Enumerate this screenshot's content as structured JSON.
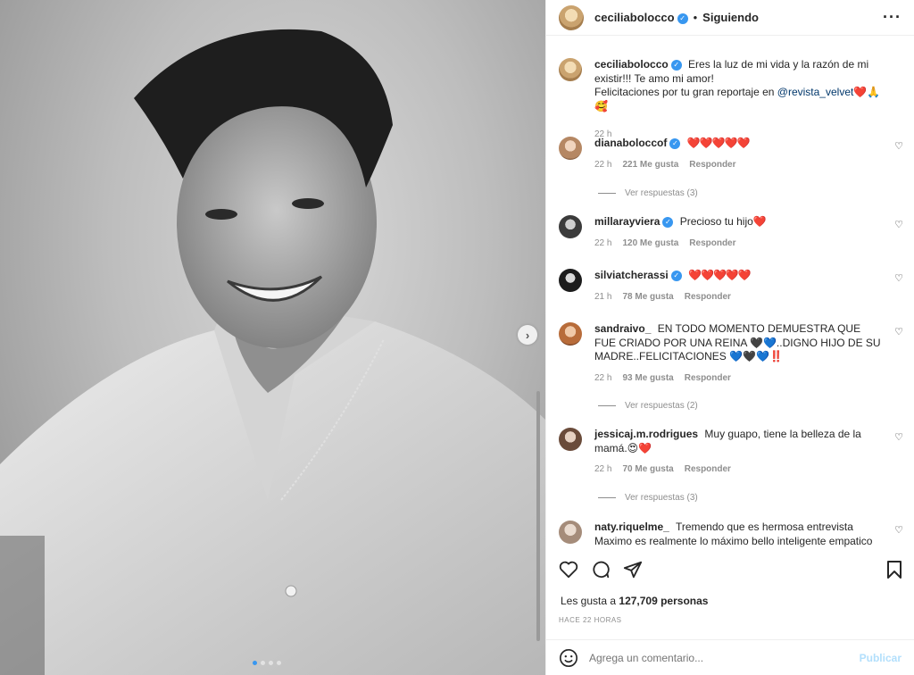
{
  "post": {
    "image_alt": "Black and white portrait photo",
    "carousel": {
      "count": 4,
      "active_index": 0
    }
  },
  "header": {
    "username": "ceciliabolocco",
    "separator": "•",
    "follow_status": "Siguiendo",
    "more_icon": "more-horizontal-icon"
  },
  "caption": {
    "username": "ceciliabolocco",
    "text_line1": "Eres la luz de mi vida y la razón de mi existir!!! Te amo mi amor!",
    "text_line2_prefix": "Felicitaciones por tu gran reportaje en ",
    "mention": "@revista_velvet",
    "emoji": "❤️🙏🥰",
    "time": "22 h"
  },
  "comments": [
    {
      "username": "dianaboloccof",
      "verified": true,
      "text": "❤️❤️❤️❤️❤️",
      "time": "22 h",
      "likes": "221 Me gusta",
      "reply": "Responder",
      "view_replies": "Ver respuestas (3)"
    },
    {
      "username": "millarayviera",
      "verified": true,
      "text": "Precioso tu hijo❤️",
      "time": "22 h",
      "likes": "120 Me gusta",
      "reply": "Responder",
      "view_replies": ""
    },
    {
      "username": "silviatcherassi",
      "verified": true,
      "text": "❤️❤️❤️❤️❤️",
      "time": "21 h",
      "likes": "78 Me gusta",
      "reply": "Responder",
      "view_replies": ""
    },
    {
      "username": "sandraivo_",
      "verified": false,
      "text": "EN TODO MOMENTO DEMUESTRA QUE FUE CRIADO POR UNA REINA 🖤💙..DIGNO HIJO DE SU MADRE..FELICITACIONES 💙🖤💙‼️",
      "time": "22 h",
      "likes": "93 Me gusta",
      "reply": "Responder",
      "view_replies": "Ver respuestas (2)"
    },
    {
      "username": "jessicaj.m.rodrigues",
      "verified": false,
      "text": "Muy guapo, tiene la belleza de la mamá.😍❤️",
      "time": "22 h",
      "likes": "70 Me gusta",
      "reply": "Responder",
      "view_replies": "Ver respuestas (3)"
    },
    {
      "username": "naty.riquelme_",
      "verified": false,
      "text": "Tremendo que es hermosa entrevista Maximo es realmente lo máximo bello inteligente empatico humilde lo amo",
      "time": "",
      "likes": "",
      "reply": "",
      "view_replies": ""
    }
  ],
  "actions": {
    "like_icon": "heart-icon",
    "comment_icon": "comment-icon",
    "share_icon": "share-icon",
    "save_icon": "bookmark-icon"
  },
  "likes": {
    "prefix": "Les gusta a ",
    "count": "127,709 personas"
  },
  "time_ago": "HACE 22 HORAS",
  "add_comment": {
    "placeholder": "Agrega un comentario...",
    "post_label": "Publicar"
  },
  "colors": {
    "accent": "#3897f0",
    "heart": "#ed4956",
    "post_disabled": "#b2dffc",
    "muted": "#8e8e8e"
  }
}
